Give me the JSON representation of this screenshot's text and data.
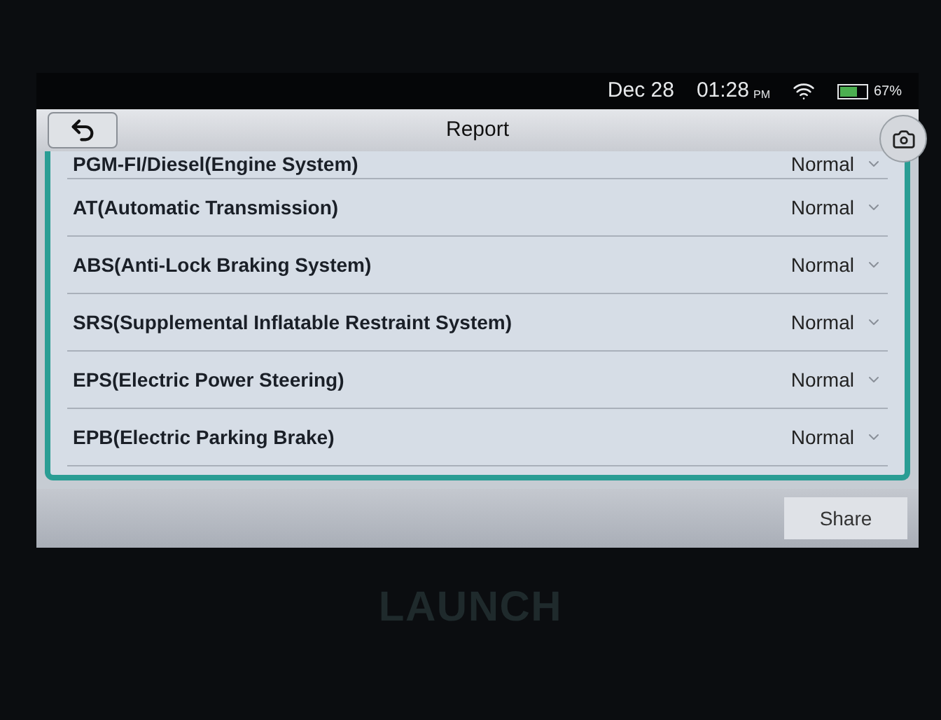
{
  "status_bar": {
    "date": "Dec 28",
    "time": "01:28",
    "meridiem": "PM",
    "battery": {
      "level": 0.67,
      "text": "67%"
    }
  },
  "window": {
    "title": "Report"
  },
  "systems": [
    {
      "name": "PGM-FI/Diesel(Engine System)",
      "status": "Normal"
    },
    {
      "name": "AT(Automatic Transmission)",
      "status": "Normal"
    },
    {
      "name": "ABS(Anti-Lock Braking System)",
      "status": "Normal"
    },
    {
      "name": "SRS(Supplemental Inflatable Restraint System)",
      "status": "Normal"
    },
    {
      "name": "EPS(Electric Power Steering)",
      "status": "Normal"
    },
    {
      "name": "EPB(Electric Parking Brake)",
      "status": "Normal"
    }
  ],
  "footer": {
    "share_button": "Share"
  },
  "device": {
    "brand": "LAUNCH"
  }
}
